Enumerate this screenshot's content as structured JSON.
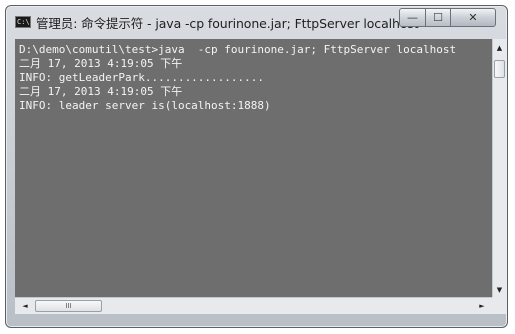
{
  "window": {
    "icon_text": "C:\\",
    "title": "管理员: 命令提示符 - java   -cp fourinone.jar; FttpServer localhost",
    "minimize_glyph": "—",
    "maximize_glyph": "☐",
    "close_glyph": "✕"
  },
  "console": {
    "lines": [
      "D:\\demo\\comutil\\test>java  -cp fourinone.jar; FttpServer localhost",
      "二月 17, 2013 4:19:05 下午",
      "INFO: getLeaderPark..................",
      "二月 17, 2013 4:19:05 下午",
      "INFO: leader server is(localhost:1888)"
    ],
    "background": "#6e6e6e",
    "text_color": "#f4f4f4"
  },
  "scrollbars": {
    "up_glyph": "▲",
    "down_glyph": "▼",
    "left_glyph": "◄",
    "right_glyph": "►",
    "h_thumb_grip": "III"
  }
}
